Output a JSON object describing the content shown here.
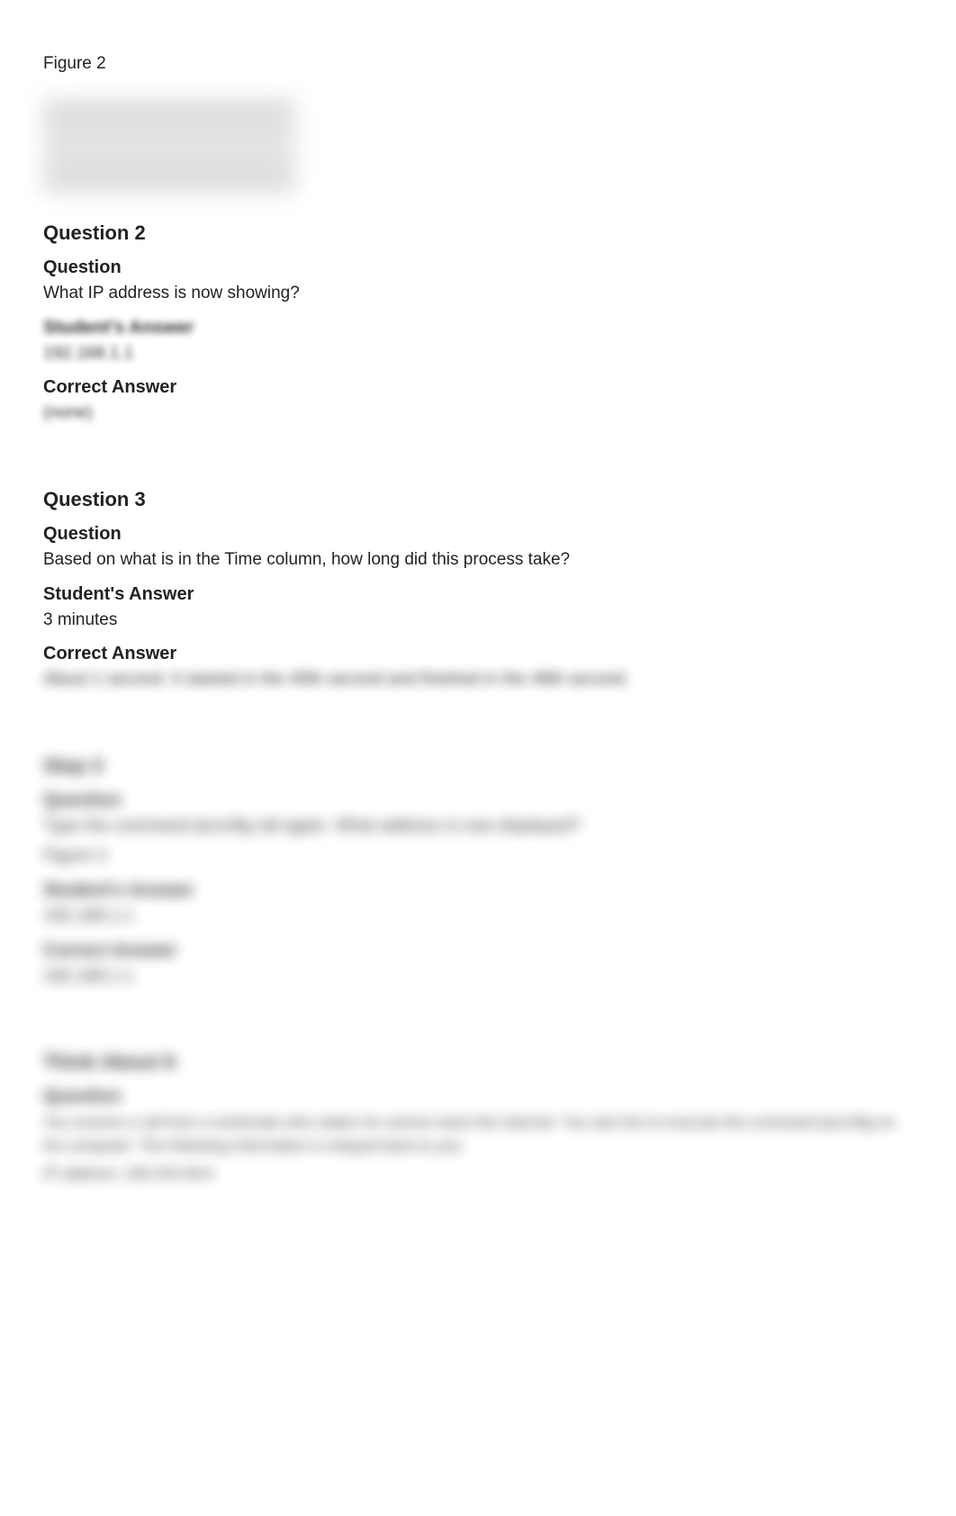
{
  "figure_top": "Figure 2",
  "q2": {
    "number": "Question 2",
    "q_heading": "Question",
    "q_text": "What IP address is now showing?",
    "sa_heading": "Student's Answer",
    "sa_text": "192.168.1.1",
    "ca_heading": "Correct Answer",
    "ca_text": "(none)"
  },
  "q3": {
    "number": "Question 3",
    "q_heading": "Question",
    "q_text": "Based on what is in the Time column, how long did this process take?",
    "sa_heading": "Student's Answer",
    "sa_text": "3 minutes",
    "ca_heading": "Correct Answer",
    "ca_text": "About 1 second. It started in the 45th second and finished in the 46th second."
  },
  "step3": {
    "number": "Step 3",
    "q_heading": "Question",
    "q_text": "Type the command ipconfig /all again. What address is now displayed?",
    "fig": "Figure 3",
    "sa_heading": "Student's Answer",
    "sa_text": "192.168.1.1",
    "ca_heading": "Correct Answer",
    "ca_text": "192.168.1.1"
  },
  "ta4": {
    "number": "Think About It",
    "q_heading": "Question",
    "q_text": "You receive a call from a workmate who states he cannot reach the Internet. You ask him to execute the command ipconfig on his computer. The following information is relayed back to you:",
    "ip_line": "IP address: 169.254.69.6"
  }
}
